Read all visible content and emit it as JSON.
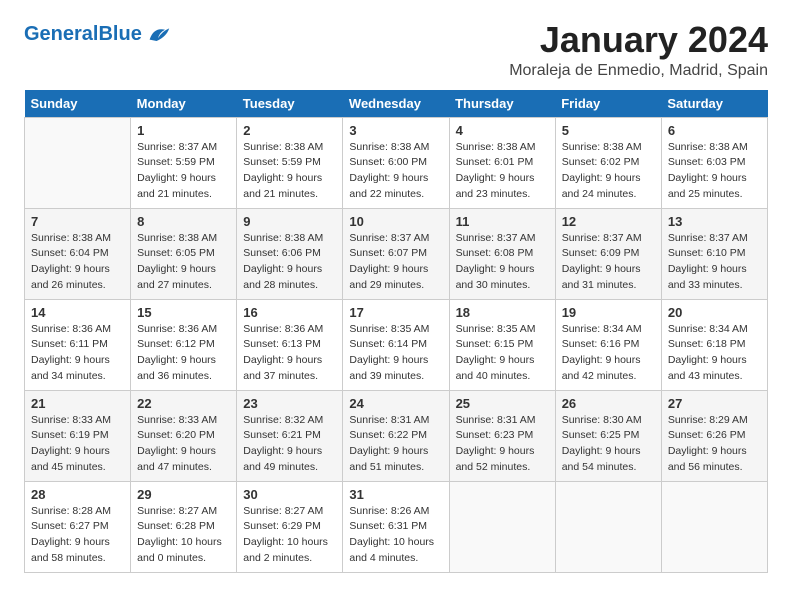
{
  "header": {
    "logo_general": "General",
    "logo_blue": "Blue",
    "month_title": "January 2024",
    "subtitle": "Moraleja de Enmedio, Madrid, Spain"
  },
  "weekdays": [
    "Sunday",
    "Monday",
    "Tuesday",
    "Wednesday",
    "Thursday",
    "Friday",
    "Saturday"
  ],
  "weeks": [
    [
      {
        "day": "",
        "sunrise": "",
        "sunset": "",
        "daylight": ""
      },
      {
        "day": "1",
        "sunrise": "Sunrise: 8:37 AM",
        "sunset": "Sunset: 5:59 PM",
        "daylight": "Daylight: 9 hours and 21 minutes."
      },
      {
        "day": "2",
        "sunrise": "Sunrise: 8:38 AM",
        "sunset": "Sunset: 5:59 PM",
        "daylight": "Daylight: 9 hours and 21 minutes."
      },
      {
        "day": "3",
        "sunrise": "Sunrise: 8:38 AM",
        "sunset": "Sunset: 6:00 PM",
        "daylight": "Daylight: 9 hours and 22 minutes."
      },
      {
        "day": "4",
        "sunrise": "Sunrise: 8:38 AM",
        "sunset": "Sunset: 6:01 PM",
        "daylight": "Daylight: 9 hours and 23 minutes."
      },
      {
        "day": "5",
        "sunrise": "Sunrise: 8:38 AM",
        "sunset": "Sunset: 6:02 PM",
        "daylight": "Daylight: 9 hours and 24 minutes."
      },
      {
        "day": "6",
        "sunrise": "Sunrise: 8:38 AM",
        "sunset": "Sunset: 6:03 PM",
        "daylight": "Daylight: 9 hours and 25 minutes."
      }
    ],
    [
      {
        "day": "7",
        "sunrise": "Sunrise: 8:38 AM",
        "sunset": "Sunset: 6:04 PM",
        "daylight": "Daylight: 9 hours and 26 minutes."
      },
      {
        "day": "8",
        "sunrise": "Sunrise: 8:38 AM",
        "sunset": "Sunset: 6:05 PM",
        "daylight": "Daylight: 9 hours and 27 minutes."
      },
      {
        "day": "9",
        "sunrise": "Sunrise: 8:38 AM",
        "sunset": "Sunset: 6:06 PM",
        "daylight": "Daylight: 9 hours and 28 minutes."
      },
      {
        "day": "10",
        "sunrise": "Sunrise: 8:37 AM",
        "sunset": "Sunset: 6:07 PM",
        "daylight": "Daylight: 9 hours and 29 minutes."
      },
      {
        "day": "11",
        "sunrise": "Sunrise: 8:37 AM",
        "sunset": "Sunset: 6:08 PM",
        "daylight": "Daylight: 9 hours and 30 minutes."
      },
      {
        "day": "12",
        "sunrise": "Sunrise: 8:37 AM",
        "sunset": "Sunset: 6:09 PM",
        "daylight": "Daylight: 9 hours and 31 minutes."
      },
      {
        "day": "13",
        "sunrise": "Sunrise: 8:37 AM",
        "sunset": "Sunset: 6:10 PM",
        "daylight": "Daylight: 9 hours and 33 minutes."
      }
    ],
    [
      {
        "day": "14",
        "sunrise": "Sunrise: 8:36 AM",
        "sunset": "Sunset: 6:11 PM",
        "daylight": "Daylight: 9 hours and 34 minutes."
      },
      {
        "day": "15",
        "sunrise": "Sunrise: 8:36 AM",
        "sunset": "Sunset: 6:12 PM",
        "daylight": "Daylight: 9 hours and 36 minutes."
      },
      {
        "day": "16",
        "sunrise": "Sunrise: 8:36 AM",
        "sunset": "Sunset: 6:13 PM",
        "daylight": "Daylight: 9 hours and 37 minutes."
      },
      {
        "day": "17",
        "sunrise": "Sunrise: 8:35 AM",
        "sunset": "Sunset: 6:14 PM",
        "daylight": "Daylight: 9 hours and 39 minutes."
      },
      {
        "day": "18",
        "sunrise": "Sunrise: 8:35 AM",
        "sunset": "Sunset: 6:15 PM",
        "daylight": "Daylight: 9 hours and 40 minutes."
      },
      {
        "day": "19",
        "sunrise": "Sunrise: 8:34 AM",
        "sunset": "Sunset: 6:16 PM",
        "daylight": "Daylight: 9 hours and 42 minutes."
      },
      {
        "day": "20",
        "sunrise": "Sunrise: 8:34 AM",
        "sunset": "Sunset: 6:18 PM",
        "daylight": "Daylight: 9 hours and 43 minutes."
      }
    ],
    [
      {
        "day": "21",
        "sunrise": "Sunrise: 8:33 AM",
        "sunset": "Sunset: 6:19 PM",
        "daylight": "Daylight: 9 hours and 45 minutes."
      },
      {
        "day": "22",
        "sunrise": "Sunrise: 8:33 AM",
        "sunset": "Sunset: 6:20 PM",
        "daylight": "Daylight: 9 hours and 47 minutes."
      },
      {
        "day": "23",
        "sunrise": "Sunrise: 8:32 AM",
        "sunset": "Sunset: 6:21 PM",
        "daylight": "Daylight: 9 hours and 49 minutes."
      },
      {
        "day": "24",
        "sunrise": "Sunrise: 8:31 AM",
        "sunset": "Sunset: 6:22 PM",
        "daylight": "Daylight: 9 hours and 51 minutes."
      },
      {
        "day": "25",
        "sunrise": "Sunrise: 8:31 AM",
        "sunset": "Sunset: 6:23 PM",
        "daylight": "Daylight: 9 hours and 52 minutes."
      },
      {
        "day": "26",
        "sunrise": "Sunrise: 8:30 AM",
        "sunset": "Sunset: 6:25 PM",
        "daylight": "Daylight: 9 hours and 54 minutes."
      },
      {
        "day": "27",
        "sunrise": "Sunrise: 8:29 AM",
        "sunset": "Sunset: 6:26 PM",
        "daylight": "Daylight: 9 hours and 56 minutes."
      }
    ],
    [
      {
        "day": "28",
        "sunrise": "Sunrise: 8:28 AM",
        "sunset": "Sunset: 6:27 PM",
        "daylight": "Daylight: 9 hours and 58 minutes."
      },
      {
        "day": "29",
        "sunrise": "Sunrise: 8:27 AM",
        "sunset": "Sunset: 6:28 PM",
        "daylight": "Daylight: 10 hours and 0 minutes."
      },
      {
        "day": "30",
        "sunrise": "Sunrise: 8:27 AM",
        "sunset": "Sunset: 6:29 PM",
        "daylight": "Daylight: 10 hours and 2 minutes."
      },
      {
        "day": "31",
        "sunrise": "Sunrise: 8:26 AM",
        "sunset": "Sunset: 6:31 PM",
        "daylight": "Daylight: 10 hours and 4 minutes."
      },
      {
        "day": "",
        "sunrise": "",
        "sunset": "",
        "daylight": ""
      },
      {
        "day": "",
        "sunrise": "",
        "sunset": "",
        "daylight": ""
      },
      {
        "day": "",
        "sunrise": "",
        "sunset": "",
        "daylight": ""
      }
    ]
  ]
}
